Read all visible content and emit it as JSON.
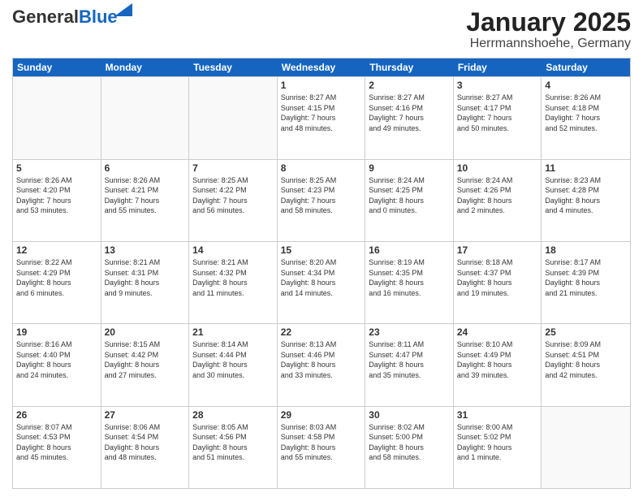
{
  "header": {
    "logo_general": "General",
    "logo_blue": "Blue",
    "month": "January 2025",
    "location": "Herrmannshoehe, Germany"
  },
  "weekdays": [
    "Sunday",
    "Monday",
    "Tuesday",
    "Wednesday",
    "Thursday",
    "Friday",
    "Saturday"
  ],
  "rows": [
    [
      {
        "day": "",
        "info": ""
      },
      {
        "day": "",
        "info": ""
      },
      {
        "day": "",
        "info": ""
      },
      {
        "day": "1",
        "info": "Sunrise: 8:27 AM\nSunset: 4:15 PM\nDaylight: 7 hours\nand 48 minutes."
      },
      {
        "day": "2",
        "info": "Sunrise: 8:27 AM\nSunset: 4:16 PM\nDaylight: 7 hours\nand 49 minutes."
      },
      {
        "day": "3",
        "info": "Sunrise: 8:27 AM\nSunset: 4:17 PM\nDaylight: 7 hours\nand 50 minutes."
      },
      {
        "day": "4",
        "info": "Sunrise: 8:26 AM\nSunset: 4:18 PM\nDaylight: 7 hours\nand 52 minutes."
      }
    ],
    [
      {
        "day": "5",
        "info": "Sunrise: 8:26 AM\nSunset: 4:20 PM\nDaylight: 7 hours\nand 53 minutes."
      },
      {
        "day": "6",
        "info": "Sunrise: 8:26 AM\nSunset: 4:21 PM\nDaylight: 7 hours\nand 55 minutes."
      },
      {
        "day": "7",
        "info": "Sunrise: 8:25 AM\nSunset: 4:22 PM\nDaylight: 7 hours\nand 56 minutes."
      },
      {
        "day": "8",
        "info": "Sunrise: 8:25 AM\nSunset: 4:23 PM\nDaylight: 7 hours\nand 58 minutes."
      },
      {
        "day": "9",
        "info": "Sunrise: 8:24 AM\nSunset: 4:25 PM\nDaylight: 8 hours\nand 0 minutes."
      },
      {
        "day": "10",
        "info": "Sunrise: 8:24 AM\nSunset: 4:26 PM\nDaylight: 8 hours\nand 2 minutes."
      },
      {
        "day": "11",
        "info": "Sunrise: 8:23 AM\nSunset: 4:28 PM\nDaylight: 8 hours\nand 4 minutes."
      }
    ],
    [
      {
        "day": "12",
        "info": "Sunrise: 8:22 AM\nSunset: 4:29 PM\nDaylight: 8 hours\nand 6 minutes."
      },
      {
        "day": "13",
        "info": "Sunrise: 8:21 AM\nSunset: 4:31 PM\nDaylight: 8 hours\nand 9 minutes."
      },
      {
        "day": "14",
        "info": "Sunrise: 8:21 AM\nSunset: 4:32 PM\nDaylight: 8 hours\nand 11 minutes."
      },
      {
        "day": "15",
        "info": "Sunrise: 8:20 AM\nSunset: 4:34 PM\nDaylight: 8 hours\nand 14 minutes."
      },
      {
        "day": "16",
        "info": "Sunrise: 8:19 AM\nSunset: 4:35 PM\nDaylight: 8 hours\nand 16 minutes."
      },
      {
        "day": "17",
        "info": "Sunrise: 8:18 AM\nSunset: 4:37 PM\nDaylight: 8 hours\nand 19 minutes."
      },
      {
        "day": "18",
        "info": "Sunrise: 8:17 AM\nSunset: 4:39 PM\nDaylight: 8 hours\nand 21 minutes."
      }
    ],
    [
      {
        "day": "19",
        "info": "Sunrise: 8:16 AM\nSunset: 4:40 PM\nDaylight: 8 hours\nand 24 minutes."
      },
      {
        "day": "20",
        "info": "Sunrise: 8:15 AM\nSunset: 4:42 PM\nDaylight: 8 hours\nand 27 minutes."
      },
      {
        "day": "21",
        "info": "Sunrise: 8:14 AM\nSunset: 4:44 PM\nDaylight: 8 hours\nand 30 minutes."
      },
      {
        "day": "22",
        "info": "Sunrise: 8:13 AM\nSunset: 4:46 PM\nDaylight: 8 hours\nand 33 minutes."
      },
      {
        "day": "23",
        "info": "Sunrise: 8:11 AM\nSunset: 4:47 PM\nDaylight: 8 hours\nand 35 minutes."
      },
      {
        "day": "24",
        "info": "Sunrise: 8:10 AM\nSunset: 4:49 PM\nDaylight: 8 hours\nand 39 minutes."
      },
      {
        "day": "25",
        "info": "Sunrise: 8:09 AM\nSunset: 4:51 PM\nDaylight: 8 hours\nand 42 minutes."
      }
    ],
    [
      {
        "day": "26",
        "info": "Sunrise: 8:07 AM\nSunset: 4:53 PM\nDaylight: 8 hours\nand 45 minutes."
      },
      {
        "day": "27",
        "info": "Sunrise: 8:06 AM\nSunset: 4:54 PM\nDaylight: 8 hours\nand 48 minutes."
      },
      {
        "day": "28",
        "info": "Sunrise: 8:05 AM\nSunset: 4:56 PM\nDaylight: 8 hours\nand 51 minutes."
      },
      {
        "day": "29",
        "info": "Sunrise: 8:03 AM\nSunset: 4:58 PM\nDaylight: 8 hours\nand 55 minutes."
      },
      {
        "day": "30",
        "info": "Sunrise: 8:02 AM\nSunset: 5:00 PM\nDaylight: 8 hours\nand 58 minutes."
      },
      {
        "day": "31",
        "info": "Sunrise: 8:00 AM\nSunset: 5:02 PM\nDaylight: 9 hours\nand 1 minute."
      },
      {
        "day": "",
        "info": ""
      }
    ]
  ]
}
